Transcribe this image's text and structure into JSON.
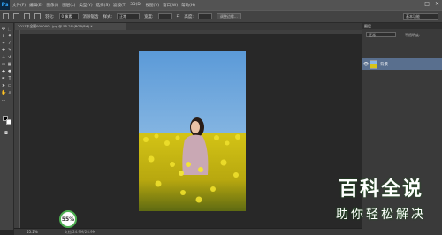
{
  "app": {
    "logo": "Ps",
    "menu": [
      "文件(F)",
      "编辑(E)",
      "图像(I)",
      "图层(L)",
      "类型(Y)",
      "选择(S)",
      "滤镜(T)",
      "3D(D)",
      "视图(V)",
      "窗口(W)",
      "帮助(H)"
    ],
    "window_controls": [
      "—",
      "□",
      "✕"
    ]
  },
  "options": {
    "feather_label": "羽化:",
    "feather_value": "0 像素",
    "antialias_label": "消除锯齿",
    "style_label": "样式:",
    "style_value": "正常",
    "width_label": "宽度:",
    "height_label": "高度:",
    "refine_button": "调整边缘...",
    "workspace": "基本功能"
  },
  "document": {
    "tab_title": "2017年全国0000001.jpg @ 55.2%(RGB/8#) *",
    "zoom_status": "55.2%",
    "doc_info": "文档:24.9M/24.9M"
  },
  "layers_panel": {
    "tab_label": "图层",
    "mode_label": "正常",
    "opacity_label": "不透明度:",
    "layer_name": "背景"
  },
  "overlay": {
    "watermark_title": "百科全说",
    "watermark_subtitle": "助你轻松解决",
    "zoom_badge_value": "55%"
  },
  "colors": {
    "chrome": "#535353",
    "canvas_bg": "#282828",
    "selected_layer": "#596f8e",
    "accent_green": "#4caf50"
  }
}
